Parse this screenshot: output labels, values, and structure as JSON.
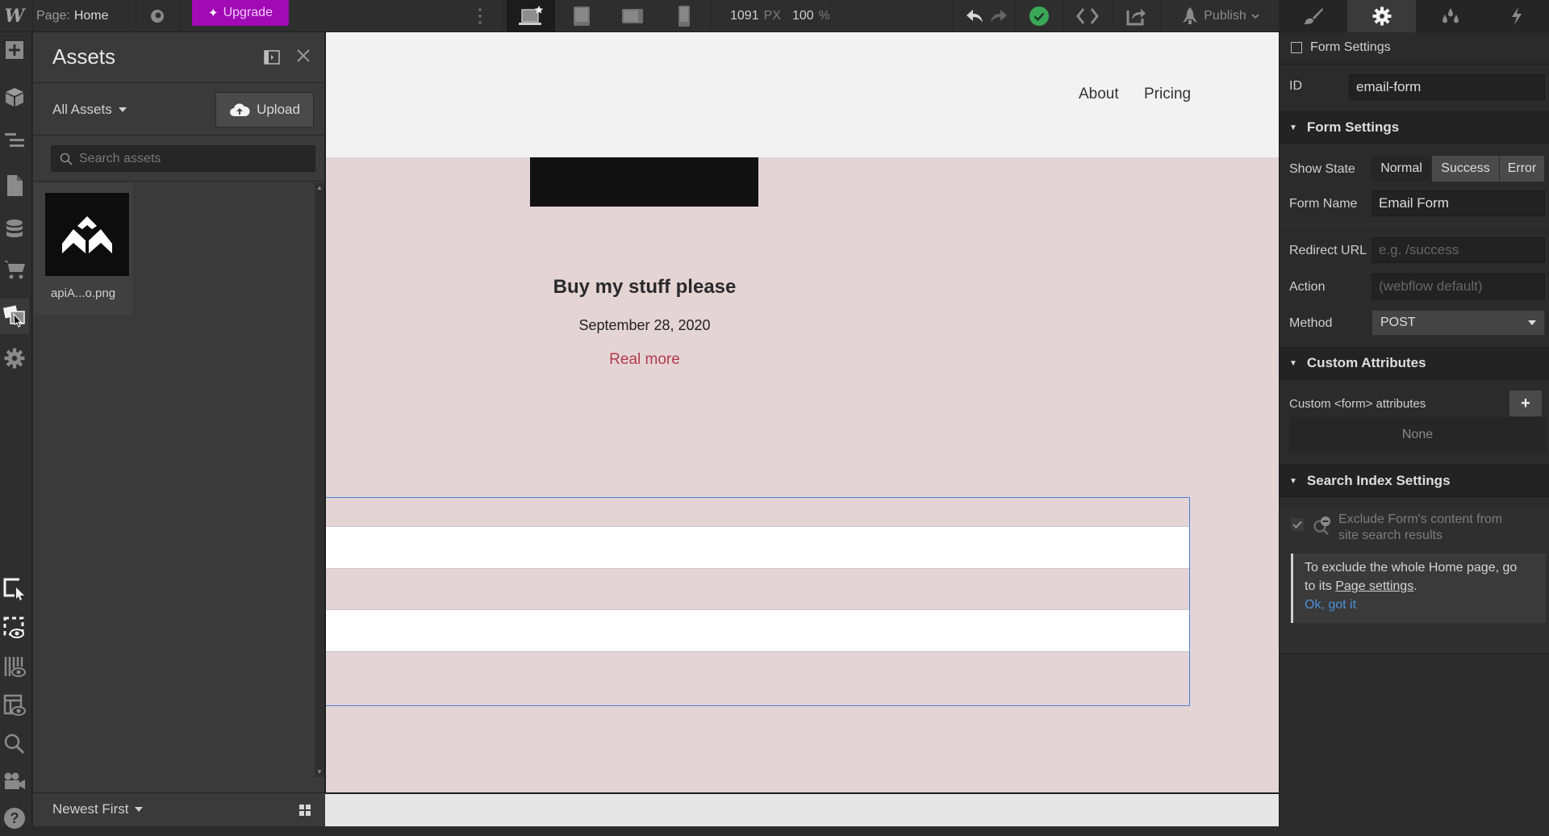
{
  "topbar": {
    "logo": "W",
    "page_prefix": "Page:",
    "page_name": "Home",
    "upgrade_label": "Upgrade",
    "viewport_width": "1091",
    "viewport_width_unit": "PX",
    "zoom": "100",
    "zoom_unit": "%",
    "publish_label": "Publish",
    "devices": [
      "desktop",
      "tablet",
      "mobile-landscape",
      "mobile-portrait"
    ],
    "active_device": "desktop",
    "panel_tabs": [
      "style",
      "settings",
      "interactions",
      "lightning"
    ],
    "active_panel_tab": "settings",
    "status": "saved"
  },
  "rail": {
    "items": [
      "add",
      "symbols",
      "navigator",
      "pages",
      "cms",
      "ecommerce",
      "assets",
      "settings"
    ],
    "active": "assets",
    "bottom_items": [
      "select-tool",
      "show-hidden",
      "x-ray",
      "layout-preview",
      "search",
      "video-tutorials",
      "help"
    ]
  },
  "assets": {
    "title": "Assets",
    "filter_label": "All Assets",
    "upload_label": "Upload",
    "search_placeholder": "Search assets",
    "search_value": "",
    "files": [
      {
        "name": "apiA...o.png"
      }
    ],
    "sort_label": "Newest First"
  },
  "canvas": {
    "nav_links": [
      "About",
      "Pricing"
    ],
    "post_title": "Buy my stuff please",
    "post_date": "September 28, 2020",
    "post_link": "Real more"
  },
  "settings": {
    "element_label": "Form Settings",
    "id_label": "ID",
    "id_value": "email-form",
    "form_section": "Form Settings",
    "show_state_label": "Show State",
    "states": [
      "Normal",
      "Success",
      "Error"
    ],
    "active_state": "Normal",
    "form_name_label": "Form Name",
    "form_name_value": "Email Form",
    "redirect_label": "Redirect URL",
    "redirect_placeholder": "e.g. /success",
    "action_label": "Action",
    "action_placeholder": "(webflow default)",
    "method_label": "Method",
    "method_value": "POST",
    "custom_attr_section": "Custom Attributes",
    "custom_attr_label": "Custom <form> attributes",
    "custom_attr_empty": "None",
    "search_index_section": "Search Index Settings",
    "exclude_label_line1": "Exclude Form's content from",
    "exclude_label_line2": "site search results",
    "exclude_checked": true,
    "hint_text_1": "To exclude the whole Home page, go",
    "hint_text_2": "to its ",
    "hint_link": "Page settings",
    "hint_text_3": ".",
    "hint_dismiss": "Ok, got it"
  },
  "colors": {
    "upgrade": "#a10ab5",
    "status_ok": "#3aa757",
    "selection": "#4d83d6",
    "link": "#b23b4c",
    "canvas_bg": "#e4d4d6"
  }
}
